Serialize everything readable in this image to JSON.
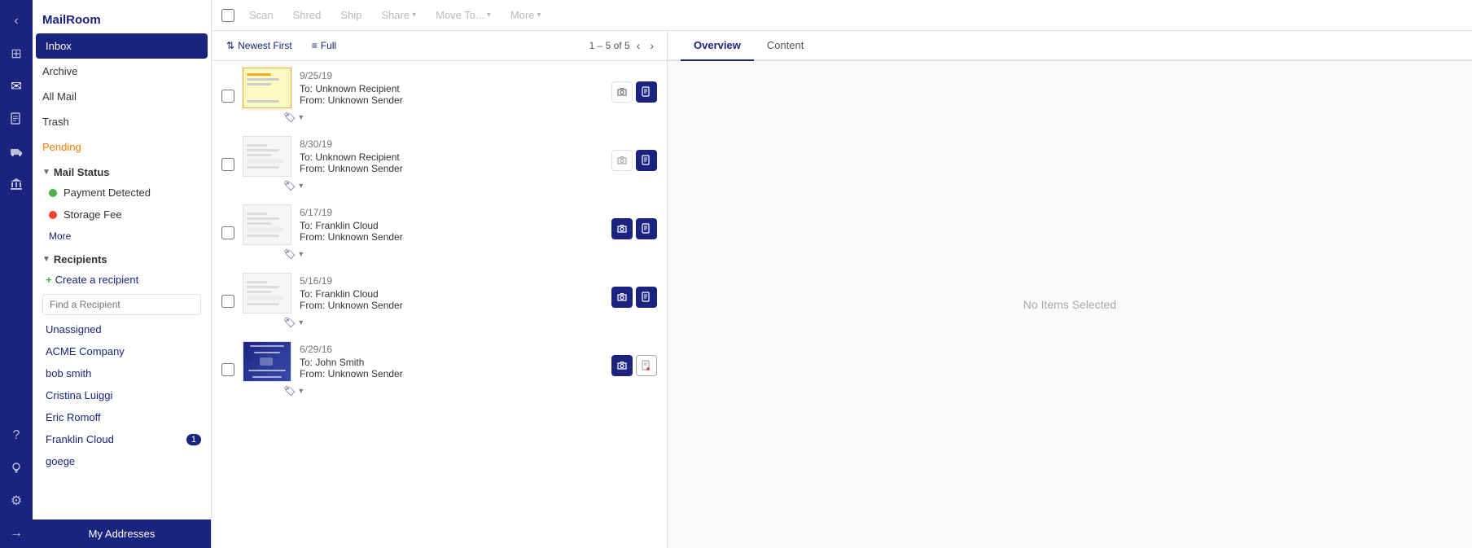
{
  "app": {
    "title": "MailRoom"
  },
  "iconBar": {
    "items": [
      {
        "name": "chevron-left-icon",
        "symbol": "‹",
        "active": false
      },
      {
        "name": "grid-icon",
        "symbol": "⊞",
        "active": false
      },
      {
        "name": "mail-icon",
        "symbol": "✉",
        "active": true
      },
      {
        "name": "document-icon",
        "symbol": "⊟",
        "active": false
      },
      {
        "name": "truck-icon",
        "symbol": "🚚",
        "active": false
      },
      {
        "name": "bank-icon",
        "symbol": "🏦",
        "active": false
      },
      {
        "name": "question-icon",
        "symbol": "?",
        "active": false
      },
      {
        "name": "bulb-icon",
        "symbol": "💡",
        "active": false
      },
      {
        "name": "settings-icon",
        "symbol": "⚙",
        "active": false
      },
      {
        "name": "arrow-right-icon",
        "symbol": "→",
        "active": false
      }
    ]
  },
  "sidebar": {
    "title": "MailRoom",
    "navItems": [
      {
        "label": "Inbox",
        "active": true
      },
      {
        "label": "Archive",
        "active": false
      },
      {
        "label": "All Mail",
        "active": false
      },
      {
        "label": "Trash",
        "active": false
      },
      {
        "label": "Pending",
        "active": false,
        "pending": true
      }
    ],
    "mailStatus": {
      "header": "Mail Status",
      "items": [
        {
          "label": "Payment Detected",
          "dotClass": "dot-green"
        },
        {
          "label": "Storage Fee",
          "dotClass": "dot-red"
        }
      ],
      "moreLabel": "More"
    },
    "recipients": {
      "header": "Recipients",
      "createLabel": "Create a recipient",
      "findPlaceholder": "Find a Recipient",
      "items": [
        {
          "label": "Unassigned",
          "badge": null
        },
        {
          "label": "ACME Company",
          "badge": null
        },
        {
          "label": "bob smith",
          "badge": null
        },
        {
          "label": "Cristina Luiggi",
          "badge": null
        },
        {
          "label": "Eric Romoff",
          "badge": null
        },
        {
          "label": "Franklin Cloud",
          "badge": "1"
        },
        {
          "label": "goege",
          "badge": null
        }
      ]
    },
    "myAddressesLabel": "My Addresses"
  },
  "toolbar": {
    "scanLabel": "Scan",
    "shredLabel": "Shred",
    "shipLabel": "Ship",
    "shareLabel": "Share",
    "moveToLabel": "Move To...",
    "moreLabel": "More"
  },
  "mailList": {
    "sortLabel": "Newest First",
    "viewLabel": "Full",
    "pagination": {
      "text": "1 – 5 of 5"
    },
    "items": [
      {
        "date": "9/25/19",
        "to": "To:  Unknown Recipient",
        "from": "From:  Unknown Sender",
        "thumbnailType": "yellow",
        "hasCamera": false,
        "hasDoc": true,
        "docOutline": false
      },
      {
        "date": "8/30/19",
        "to": "To:  Unknown Recipient",
        "from": "From:  Unknown Sender",
        "thumbnailType": "plain",
        "hasCamera": false,
        "hasDoc": true,
        "docOutline": false
      },
      {
        "date": "6/17/19",
        "to": "To:  Franklin Cloud",
        "from": "From:  Unknown Sender",
        "thumbnailType": "plain",
        "hasCamera": true,
        "hasDoc": true,
        "docOutline": false
      },
      {
        "date": "5/16/19",
        "to": "To:  Franklin Cloud",
        "from": "From:  Unknown Sender",
        "thumbnailType": "plain",
        "hasCamera": true,
        "hasDoc": true,
        "docOutline": false
      },
      {
        "date": "6/29/16",
        "to": "To:  John Smith",
        "from": "From:  Unknown Sender",
        "thumbnailType": "card",
        "hasCamera": true,
        "hasDoc": false,
        "docOutline": true
      }
    ]
  },
  "rightPanel": {
    "tabs": [
      {
        "label": "Overview",
        "active": true
      },
      {
        "label": "Content",
        "active": false
      }
    ],
    "emptyMessage": "No Items Selected"
  }
}
